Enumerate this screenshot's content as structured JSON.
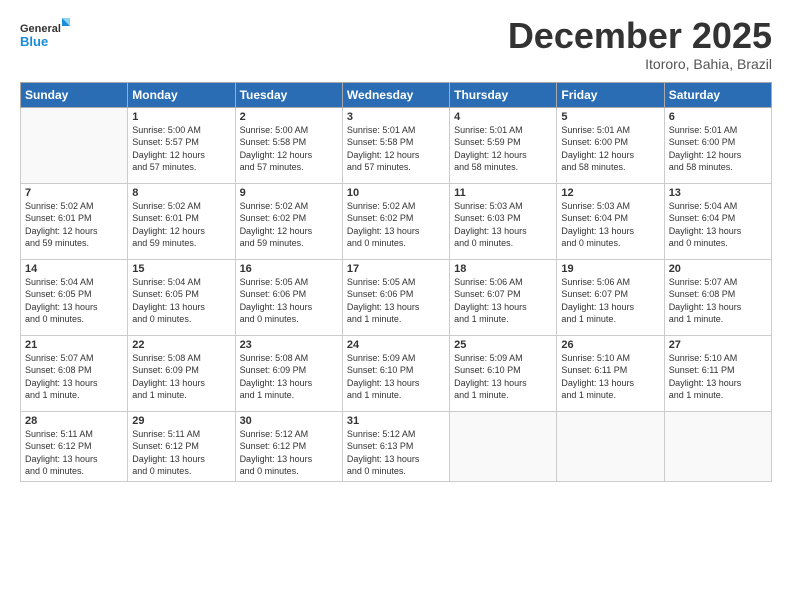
{
  "logo": {
    "text_general": "General",
    "text_blue": "Blue"
  },
  "header": {
    "month_title": "December 2025",
    "location": "Itororo, Bahia, Brazil"
  },
  "weekdays": [
    "Sunday",
    "Monday",
    "Tuesday",
    "Wednesday",
    "Thursday",
    "Friday",
    "Saturday"
  ],
  "weeks": [
    [
      {
        "day": "",
        "info": ""
      },
      {
        "day": "1",
        "info": "Sunrise: 5:00 AM\nSunset: 5:57 PM\nDaylight: 12 hours\nand 57 minutes."
      },
      {
        "day": "2",
        "info": "Sunrise: 5:00 AM\nSunset: 5:58 PM\nDaylight: 12 hours\nand 57 minutes."
      },
      {
        "day": "3",
        "info": "Sunrise: 5:01 AM\nSunset: 5:58 PM\nDaylight: 12 hours\nand 57 minutes."
      },
      {
        "day": "4",
        "info": "Sunrise: 5:01 AM\nSunset: 5:59 PM\nDaylight: 12 hours\nand 58 minutes."
      },
      {
        "day": "5",
        "info": "Sunrise: 5:01 AM\nSunset: 6:00 PM\nDaylight: 12 hours\nand 58 minutes."
      },
      {
        "day": "6",
        "info": "Sunrise: 5:01 AM\nSunset: 6:00 PM\nDaylight: 12 hours\nand 58 minutes."
      }
    ],
    [
      {
        "day": "7",
        "info": "Sunrise: 5:02 AM\nSunset: 6:01 PM\nDaylight: 12 hours\nand 59 minutes."
      },
      {
        "day": "8",
        "info": "Sunrise: 5:02 AM\nSunset: 6:01 PM\nDaylight: 12 hours\nand 59 minutes."
      },
      {
        "day": "9",
        "info": "Sunrise: 5:02 AM\nSunset: 6:02 PM\nDaylight: 12 hours\nand 59 minutes."
      },
      {
        "day": "10",
        "info": "Sunrise: 5:02 AM\nSunset: 6:02 PM\nDaylight: 13 hours\nand 0 minutes."
      },
      {
        "day": "11",
        "info": "Sunrise: 5:03 AM\nSunset: 6:03 PM\nDaylight: 13 hours\nand 0 minutes."
      },
      {
        "day": "12",
        "info": "Sunrise: 5:03 AM\nSunset: 6:04 PM\nDaylight: 13 hours\nand 0 minutes."
      },
      {
        "day": "13",
        "info": "Sunrise: 5:04 AM\nSunset: 6:04 PM\nDaylight: 13 hours\nand 0 minutes."
      }
    ],
    [
      {
        "day": "14",
        "info": "Sunrise: 5:04 AM\nSunset: 6:05 PM\nDaylight: 13 hours\nand 0 minutes."
      },
      {
        "day": "15",
        "info": "Sunrise: 5:04 AM\nSunset: 6:05 PM\nDaylight: 13 hours\nand 0 minutes."
      },
      {
        "day": "16",
        "info": "Sunrise: 5:05 AM\nSunset: 6:06 PM\nDaylight: 13 hours\nand 0 minutes."
      },
      {
        "day": "17",
        "info": "Sunrise: 5:05 AM\nSunset: 6:06 PM\nDaylight: 13 hours\nand 1 minute."
      },
      {
        "day": "18",
        "info": "Sunrise: 5:06 AM\nSunset: 6:07 PM\nDaylight: 13 hours\nand 1 minute."
      },
      {
        "day": "19",
        "info": "Sunrise: 5:06 AM\nSunset: 6:07 PM\nDaylight: 13 hours\nand 1 minute."
      },
      {
        "day": "20",
        "info": "Sunrise: 5:07 AM\nSunset: 6:08 PM\nDaylight: 13 hours\nand 1 minute."
      }
    ],
    [
      {
        "day": "21",
        "info": "Sunrise: 5:07 AM\nSunset: 6:08 PM\nDaylight: 13 hours\nand 1 minute."
      },
      {
        "day": "22",
        "info": "Sunrise: 5:08 AM\nSunset: 6:09 PM\nDaylight: 13 hours\nand 1 minute."
      },
      {
        "day": "23",
        "info": "Sunrise: 5:08 AM\nSunset: 6:09 PM\nDaylight: 13 hours\nand 1 minute."
      },
      {
        "day": "24",
        "info": "Sunrise: 5:09 AM\nSunset: 6:10 PM\nDaylight: 13 hours\nand 1 minute."
      },
      {
        "day": "25",
        "info": "Sunrise: 5:09 AM\nSunset: 6:10 PM\nDaylight: 13 hours\nand 1 minute."
      },
      {
        "day": "26",
        "info": "Sunrise: 5:10 AM\nSunset: 6:11 PM\nDaylight: 13 hours\nand 1 minute."
      },
      {
        "day": "27",
        "info": "Sunrise: 5:10 AM\nSunset: 6:11 PM\nDaylight: 13 hours\nand 1 minute."
      }
    ],
    [
      {
        "day": "28",
        "info": "Sunrise: 5:11 AM\nSunset: 6:12 PM\nDaylight: 13 hours\nand 0 minutes."
      },
      {
        "day": "29",
        "info": "Sunrise: 5:11 AM\nSunset: 6:12 PM\nDaylight: 13 hours\nand 0 minutes."
      },
      {
        "day": "30",
        "info": "Sunrise: 5:12 AM\nSunset: 6:12 PM\nDaylight: 13 hours\nand 0 minutes."
      },
      {
        "day": "31",
        "info": "Sunrise: 5:12 AM\nSunset: 6:13 PM\nDaylight: 13 hours\nand 0 minutes."
      },
      {
        "day": "",
        "info": ""
      },
      {
        "day": "",
        "info": ""
      },
      {
        "day": "",
        "info": ""
      }
    ]
  ]
}
